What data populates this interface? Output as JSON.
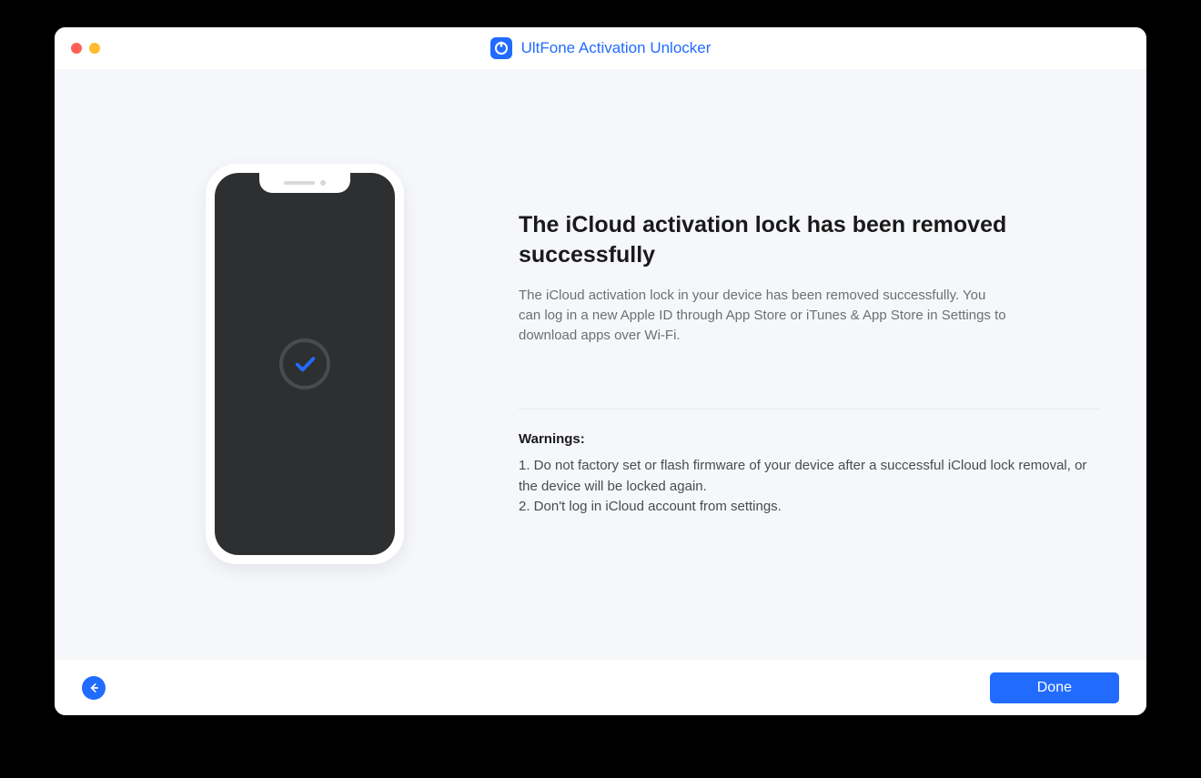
{
  "app": {
    "title": "UltFone Activation Unlocker"
  },
  "main": {
    "heading": "The iCloud activation lock has been removed successfully",
    "description": "The iCloud activation lock in your device has been removed successfully. You can log in a new Apple ID through App Store or iTunes & App Store in Settings to download apps over Wi-Fi."
  },
  "warnings": {
    "title": "Warnings:",
    "items": [
      "1. Do not factory set or flash firmware of your device after a successful iCloud lock removal, or the device will be locked again.",
      "2. Don't log in iCloud account from settings."
    ]
  },
  "footer": {
    "done_label": "Done"
  },
  "colors": {
    "accent": "#226bff"
  }
}
